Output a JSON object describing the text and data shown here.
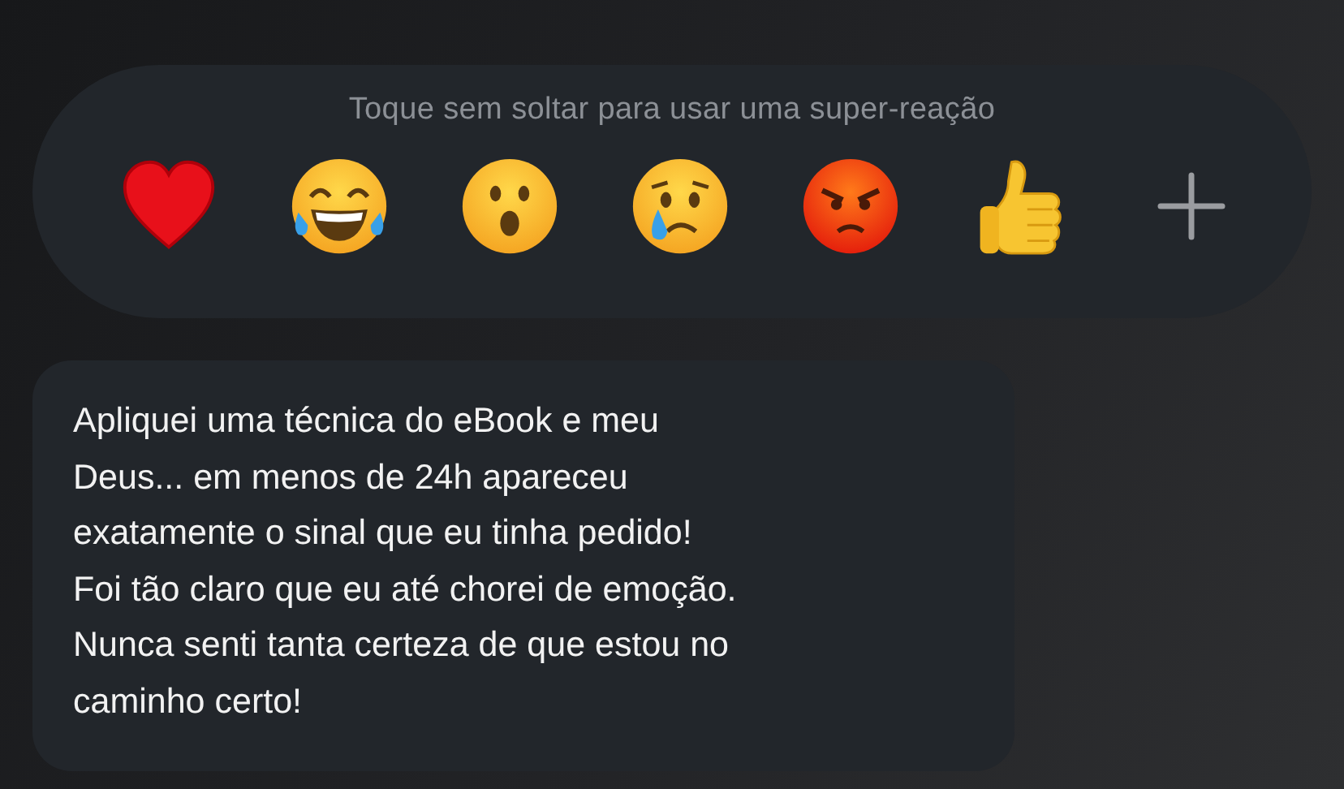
{
  "reaction_bar": {
    "hint": "Toque sem soltar para usar uma super-reação"
  },
  "message": {
    "lines": [
      "Apliquei uma técnica do eBook e meu",
      "Deus... em menos de 24h apareceu",
      "exatamente o sinal que eu tinha pedido!",
      "Foi tão claro que eu até chorei de emoção.",
      "Nunca senti tanta certeza de que estou no",
      "caminho certo!"
    ]
  }
}
